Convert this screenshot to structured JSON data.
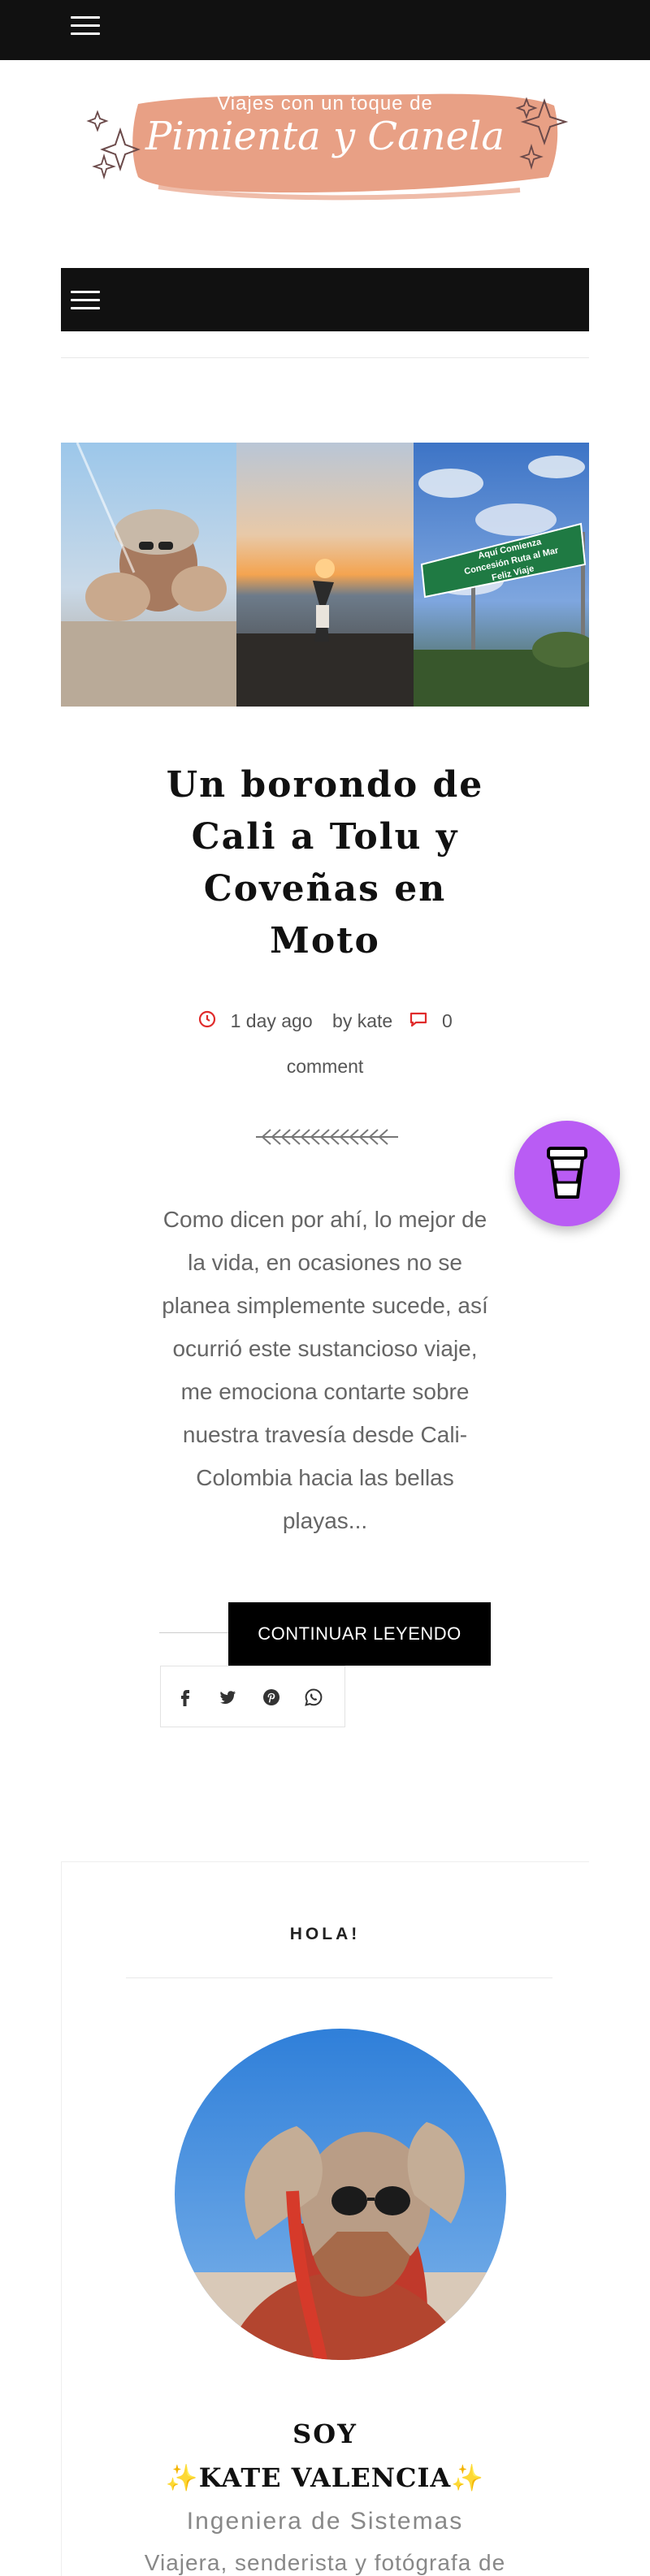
{
  "header": {
    "menu_icon": "hamburger-menu-icon"
  },
  "logo": {
    "subtitle": "Viajes con un toque de",
    "title": "Pimienta y Canela",
    "colors": {
      "brush": "#e8a085",
      "sparkle": "#6b4a4a"
    }
  },
  "nav": {
    "menu_icon": "hamburger-menu-icon"
  },
  "post": {
    "title_lines": [
      "Un borondo de",
      "Cali a Tolu y",
      "Coveñas en",
      "Moto"
    ],
    "meta": {
      "time": "1 day ago",
      "author": "by kate",
      "comments_count": "0",
      "comments_label": "comment"
    },
    "excerpt": "Como dicen por ahí, lo mejor de la vida, en ocasiones no se planea simplemente sucede, así ocurrió este sustancioso viaje, me emociona contarte sobre nuestra travesía desde Cali-Colombia hacia las bellas playas...",
    "read_more": "CONTINUAR LEYENDO",
    "road_sign": [
      "Aquí  Comienza",
      "Concesión Ruta al Mar",
      "Feliz  Viaje"
    ],
    "share_icons": [
      "facebook-icon",
      "twitter-icon",
      "pinterest-icon",
      "whatsapp-icon"
    ]
  },
  "floating_button": {
    "icon": "coffee-cup-icon",
    "color": "#b95cf4"
  },
  "widget": {
    "title": "HOLA!",
    "soy": "SOY",
    "name": "✨KATE VALENCIA✨",
    "role": "Ingeniera de Sistemas",
    "role2": "Viajera, senderista y fotógrafa de"
  },
  "colors": {
    "accent": "#e02b2b",
    "dark": "#111111",
    "text_muted": "#666666"
  }
}
